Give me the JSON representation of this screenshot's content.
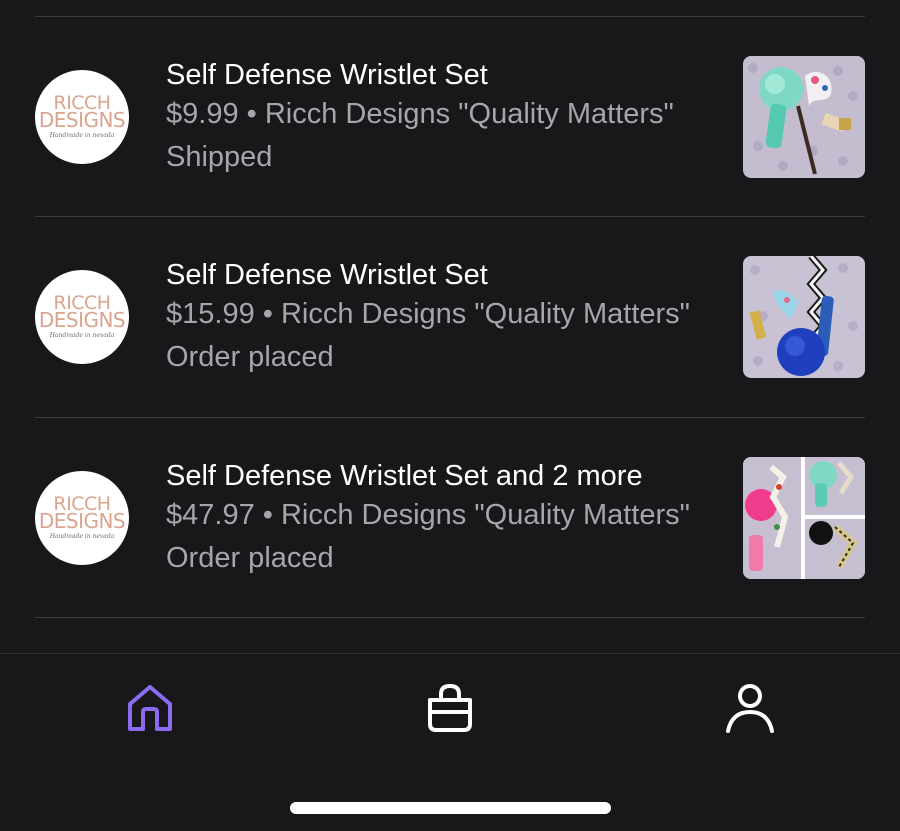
{
  "orders": [
    {
      "title": "Self Defense Wristlet Set",
      "subtitle": "$9.99 • Ricch Designs \"Quality Matters\"",
      "status": "Shipped",
      "shop_logo": {
        "line1": "RICCH",
        "line2": "DESIGNS",
        "tagline": "Handmade in nevada"
      },
      "thumbnail_icon": "product-photo-keychain-teal-pompom"
    },
    {
      "title": "Self Defense Wristlet Set",
      "subtitle": "$15.99 • Ricch Designs \"Quality Matters\"",
      "status": "Order placed",
      "shop_logo": {
        "line1": "RICCH",
        "line2": "DESIGNS",
        "tagline": "Handmade in nevada"
      },
      "thumbnail_icon": "product-photo-keychain-blue-pompom"
    },
    {
      "title": "Self Defense Wristlet Set and 2 more",
      "subtitle": "$47.97 • Ricch Designs \"Quality Matters\"",
      "status": "Order placed",
      "shop_logo": {
        "line1": "RICCH",
        "line2": "DESIGNS",
        "tagline": "Handmade in nevada"
      },
      "thumbnail_icon": "product-photo-collage"
    }
  ],
  "tabbar": {
    "items": [
      {
        "icon": "home-icon",
        "active": true
      },
      {
        "icon": "shopping-bag-icon",
        "active": false
      },
      {
        "icon": "profile-icon",
        "active": false
      }
    ],
    "active_color": "#8b6cf0",
    "inactive_color": "#ffffff"
  },
  "colors": {
    "background": "#18181b",
    "title_text": "#ffffff",
    "secondary_text": "#a5a5aa",
    "logo_text": "#d9a58e"
  }
}
